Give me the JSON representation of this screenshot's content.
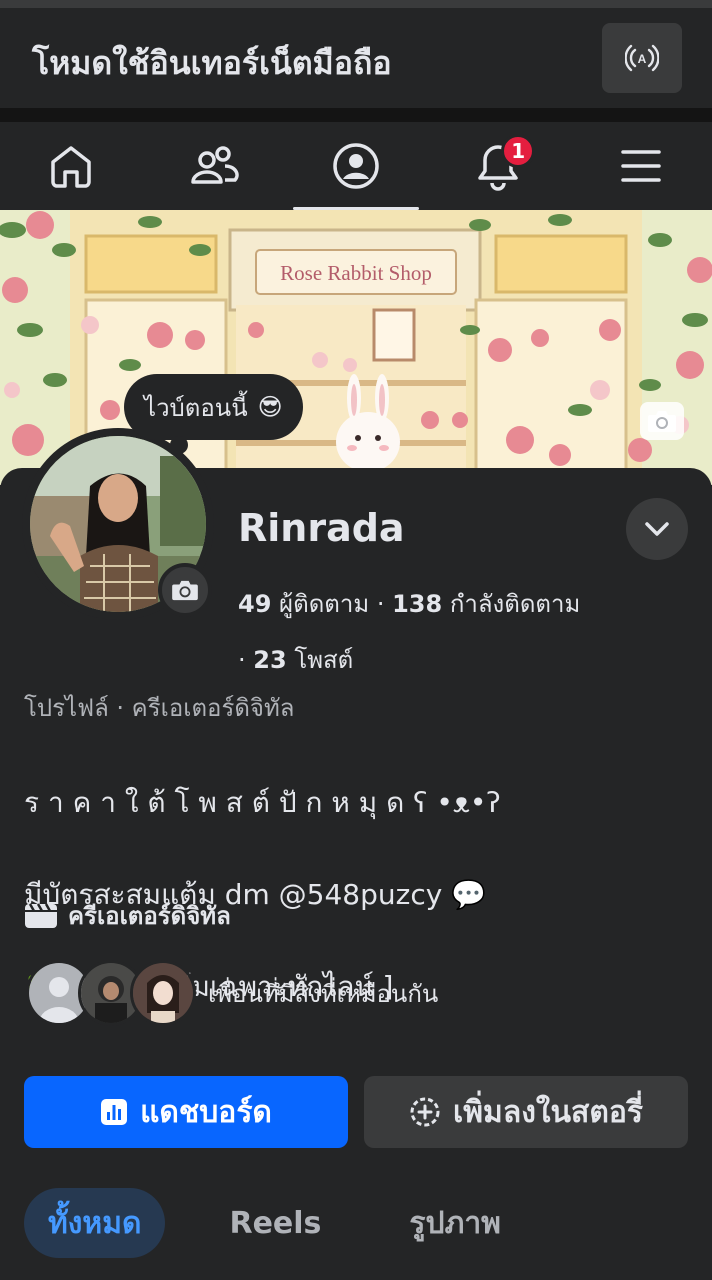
{
  "data_mode_bar": {
    "title": "โหมดใช้อินเทอร์เน็ตมือถือ",
    "icon": "mobile-data-antenna-icon"
  },
  "nav": {
    "items": [
      {
        "name": "home",
        "icon": "home-icon"
      },
      {
        "name": "friends",
        "icon": "friends-icon"
      },
      {
        "name": "profile",
        "icon": "profile-icon",
        "active": true
      },
      {
        "name": "notifications",
        "icon": "bell-icon",
        "badge": "1"
      },
      {
        "name": "menu",
        "icon": "menu-icon"
      }
    ]
  },
  "cover": {
    "shop_sign": "Rose Rabbit Shop"
  },
  "note_bubble": {
    "text": "ไวบ์ตอนนี้",
    "emoji": "😎"
  },
  "profile": {
    "name": "Rinrada",
    "followers_count": "49",
    "followers_label": "ผู้ติดตาม",
    "following_count": "138",
    "following_label": "กำลังติดตาม",
    "posts_count": "23",
    "posts_label": "โพสต์",
    "category": "โปรไฟล์ · ครีเอเตอร์ดิจิทัล",
    "bio_line1": "ร า ค า ใ ต้ โ พ ส ต์ ปั ก ห มุ ด ʕ •ᴥ•ʔ",
    "bio_line2": "มีบัตรสะสมแต้ม dm @548puzcy 💬",
    "bio_line3": "🍀 [ สะสมแต้มเฉพาะทักไลน์ ]",
    "creator_label": "ครีเอเตอร์ดิจิทัล",
    "mutual_label": "เพื่อนที่มีสิ่งที่เหมือนกัน"
  },
  "actions": {
    "dashboard_label": "แดชบอร์ด",
    "add_story_label": "เพิ่มลงในสตอรี่"
  },
  "tabs": {
    "all": "ทั้งหมด",
    "reels": "Reels",
    "photos": "รูปภาพ"
  },
  "colors": {
    "background": "#242526",
    "primary_button": "#0866ff",
    "active_tab_bg": "#263951",
    "active_tab_text": "#4599ff",
    "badge": "#e41e3f"
  }
}
